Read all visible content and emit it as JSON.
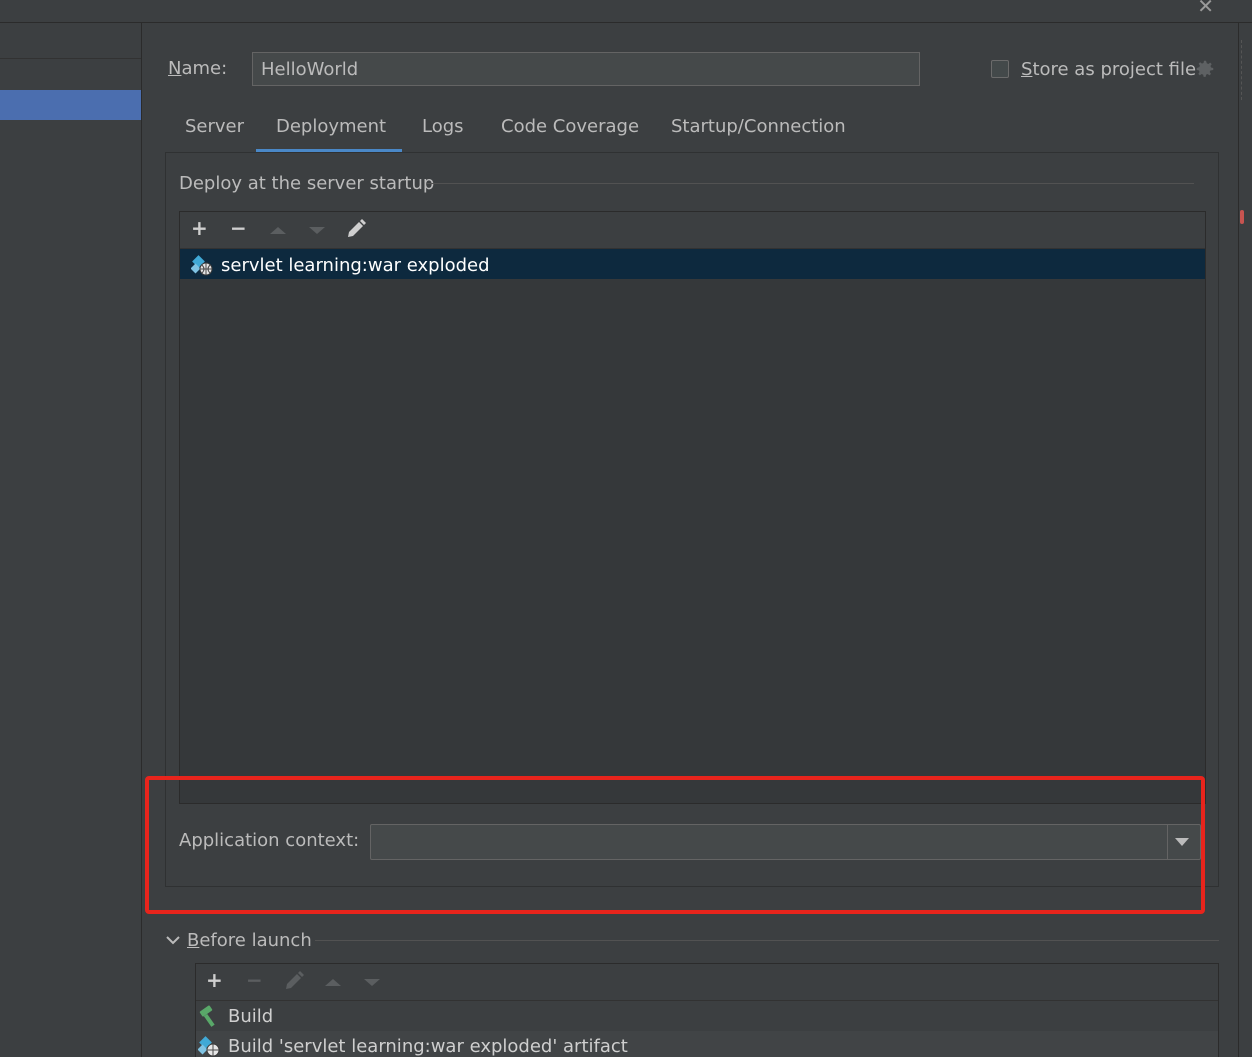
{
  "window": {
    "close_glyph": "✕"
  },
  "form": {
    "name_label": "Name:",
    "name_value": "HelloWorld",
    "store_label": "Store as project file"
  },
  "tabs": [
    {
      "label": "Server"
    },
    {
      "label": "Deployment",
      "selected": true
    },
    {
      "label": "Logs"
    },
    {
      "label": "Code Coverage"
    },
    {
      "label": "Startup/Connection"
    }
  ],
  "deploy": {
    "group_title": "Deploy at the server startup",
    "toolbar": {
      "add": "+",
      "remove": "−"
    },
    "items": [
      {
        "label": "servlet learning:war exploded",
        "icon": "artifact-web-icon",
        "selected": true
      }
    ]
  },
  "app_context": {
    "label": "Application context:",
    "value": ""
  },
  "before_launch": {
    "title": "Before launch",
    "toolbar": {
      "add": "+",
      "remove": "−"
    },
    "items": [
      {
        "label": "Build",
        "icon": "hammer-icon"
      },
      {
        "label": "Build 'servlet learning:war exploded' artifact",
        "icon": "artifact-web-icon"
      }
    ]
  },
  "colors": {
    "background": "#3c3f41",
    "accent": "#4a88c7",
    "selection": "#0d293e",
    "left_selection": "#4b6eaf",
    "annotation_red": "#e8241c"
  }
}
